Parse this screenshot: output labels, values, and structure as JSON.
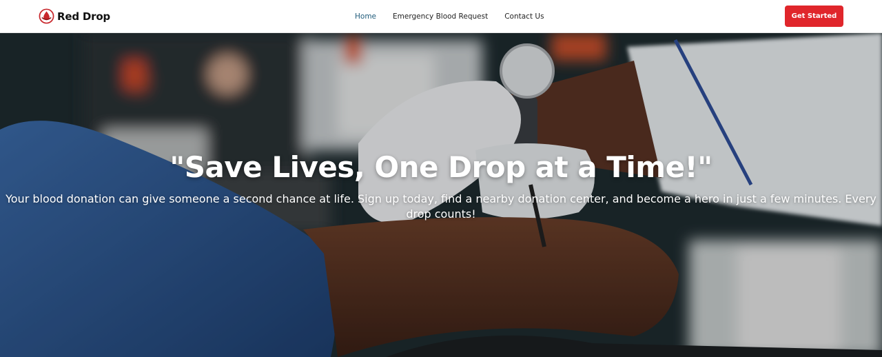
{
  "brand": {
    "name": "Red Drop",
    "logo_icon": "blood-drop-icon",
    "accent": "#e0262b"
  },
  "nav": {
    "links": [
      {
        "label": "Home",
        "active": true
      },
      {
        "label": "Emergency Blood Request",
        "active": false
      },
      {
        "label": "Contact Us",
        "active": false
      }
    ],
    "cta_label": "Get Started"
  },
  "hero": {
    "title": "\"Save Lives, One Drop at a Time!\"",
    "subtitle": "Your blood donation can give someone a second chance at life. Sign up today, find a nearby donation center, and become a hero in just a few minutes. Every drop counts!"
  }
}
